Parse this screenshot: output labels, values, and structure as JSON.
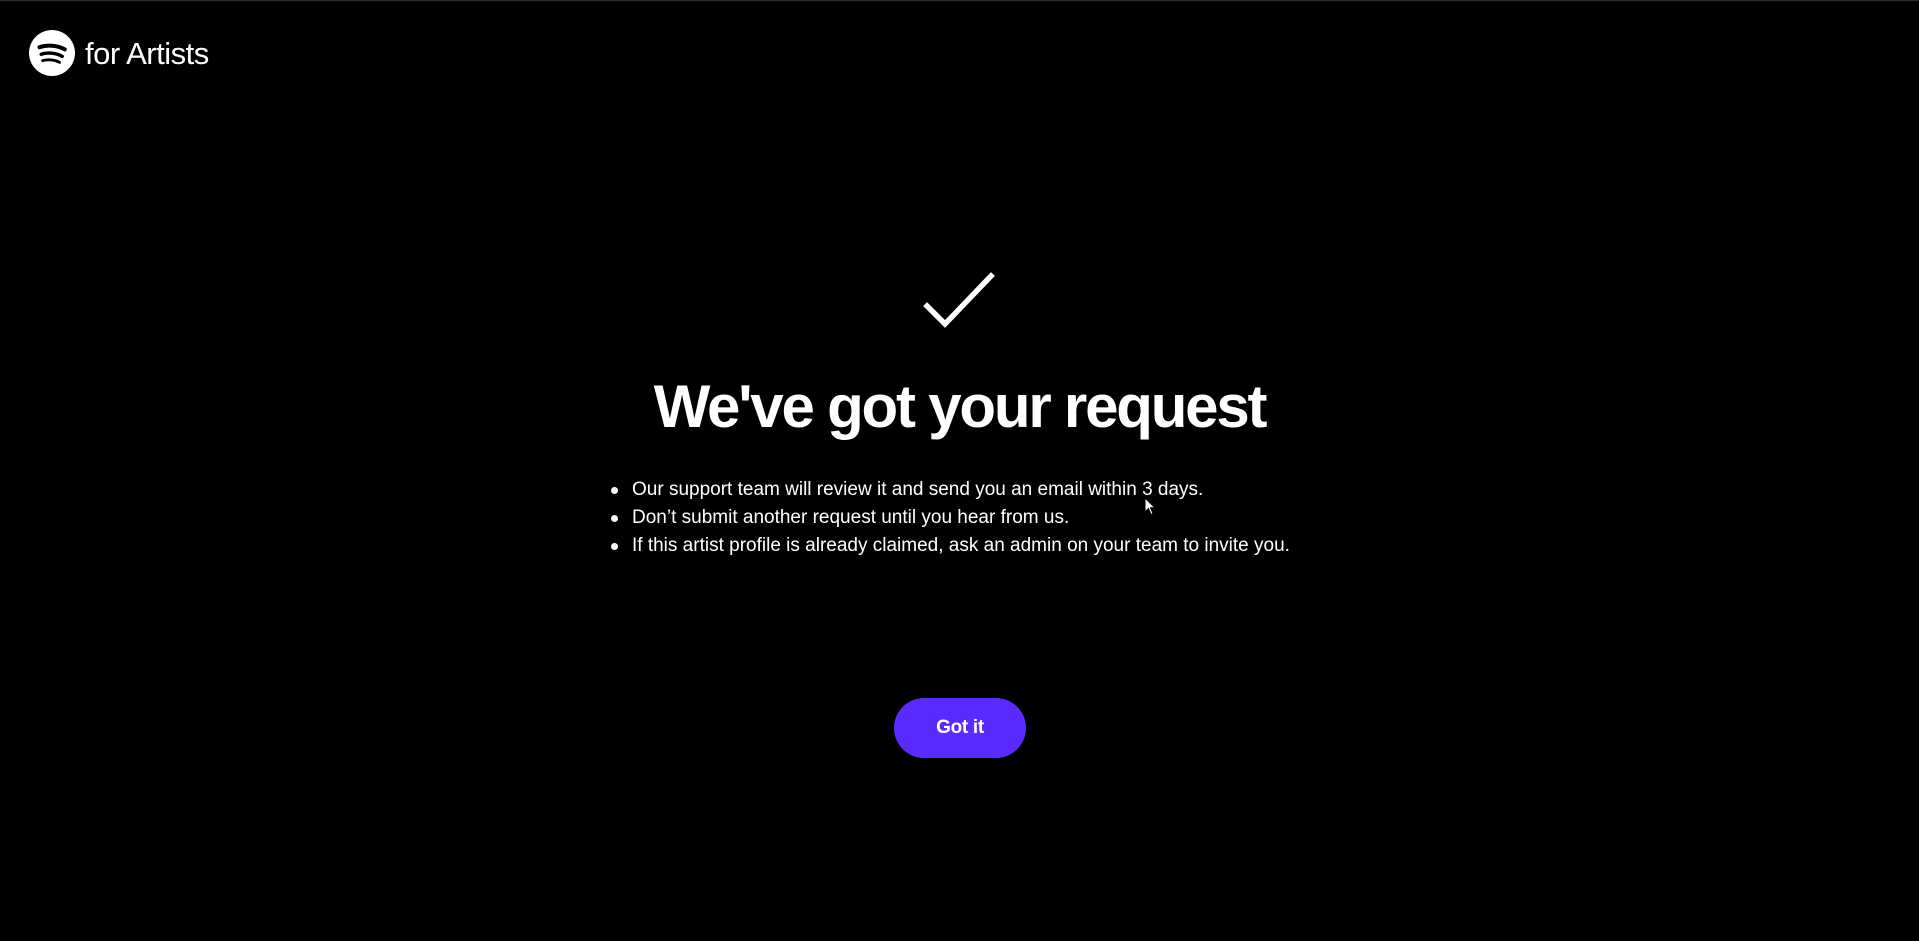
{
  "header": {
    "brand_suffix": "for Artists",
    "logo_icon": "spotify-logo-icon"
  },
  "main": {
    "status_icon": "checkmark-icon",
    "title": "We've got your request",
    "bullets": [
      "Our support team will review it and send you an email within 3 days.",
      "Don’t submit another request until you hear from us.",
      "If this artist profile is already claimed, ask an admin on your team to invite you."
    ],
    "button_label": "Got it"
  },
  "colors": {
    "background": "#000000",
    "text": "#ffffff",
    "accent": "#5a2bff"
  }
}
